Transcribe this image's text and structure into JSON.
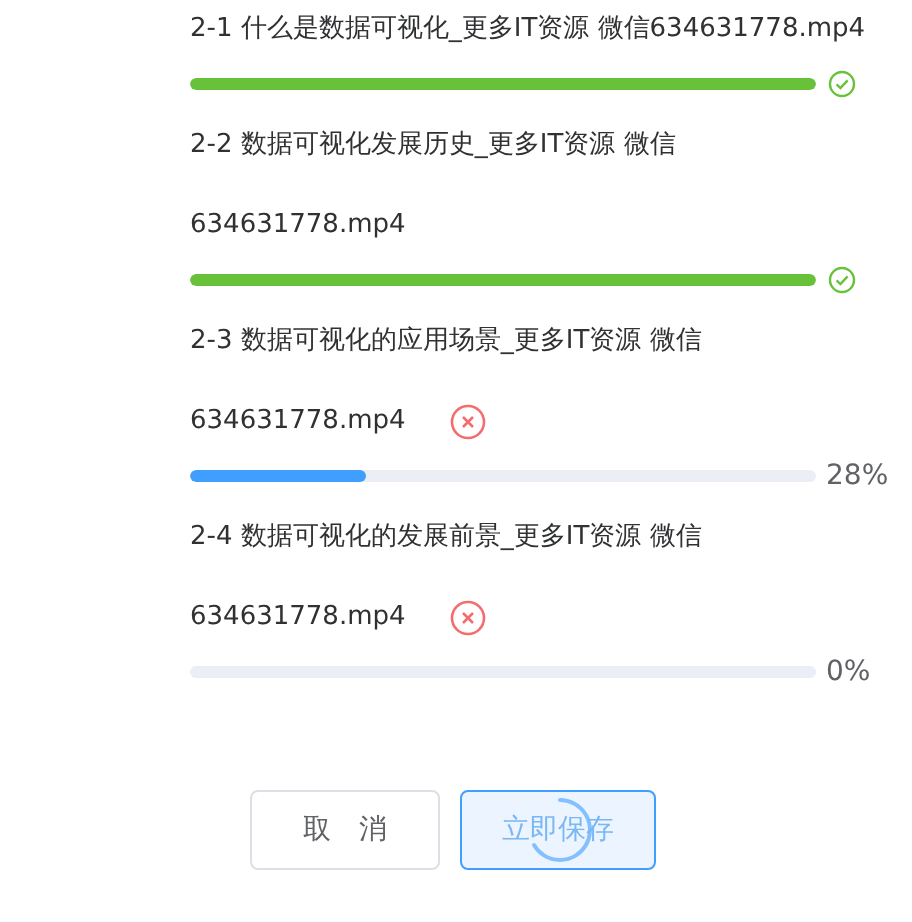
{
  "files": [
    {
      "title_lines": [
        "2-1 什么是数据可视化_更多IT资源 微信634631778.mp4"
      ],
      "kind": "done",
      "level": 1
    },
    {
      "title_lines": [
        "2-2 数据可视化发展历史_更多IT资源 微信",
        "634631778.mp4"
      ],
      "kind": "done",
      "level": 1
    },
    {
      "title_lines": [
        "2-3 数据可视化的应用场景_更多IT资源 微信",
        "634631778.mp4"
      ],
      "kind": "uploading",
      "level": 0.28,
      "percent": "28%"
    },
    {
      "title_lines": [
        "2-4 数据可视化的发展前景_更多IT资源 微信",
        "634631778.mp4"
      ],
      "kind": "uploading",
      "level": 0,
      "percent": "0%"
    }
  ],
  "buttons": {
    "cancel": "取　消",
    "save": "立即保存",
    "save_loading": true
  }
}
